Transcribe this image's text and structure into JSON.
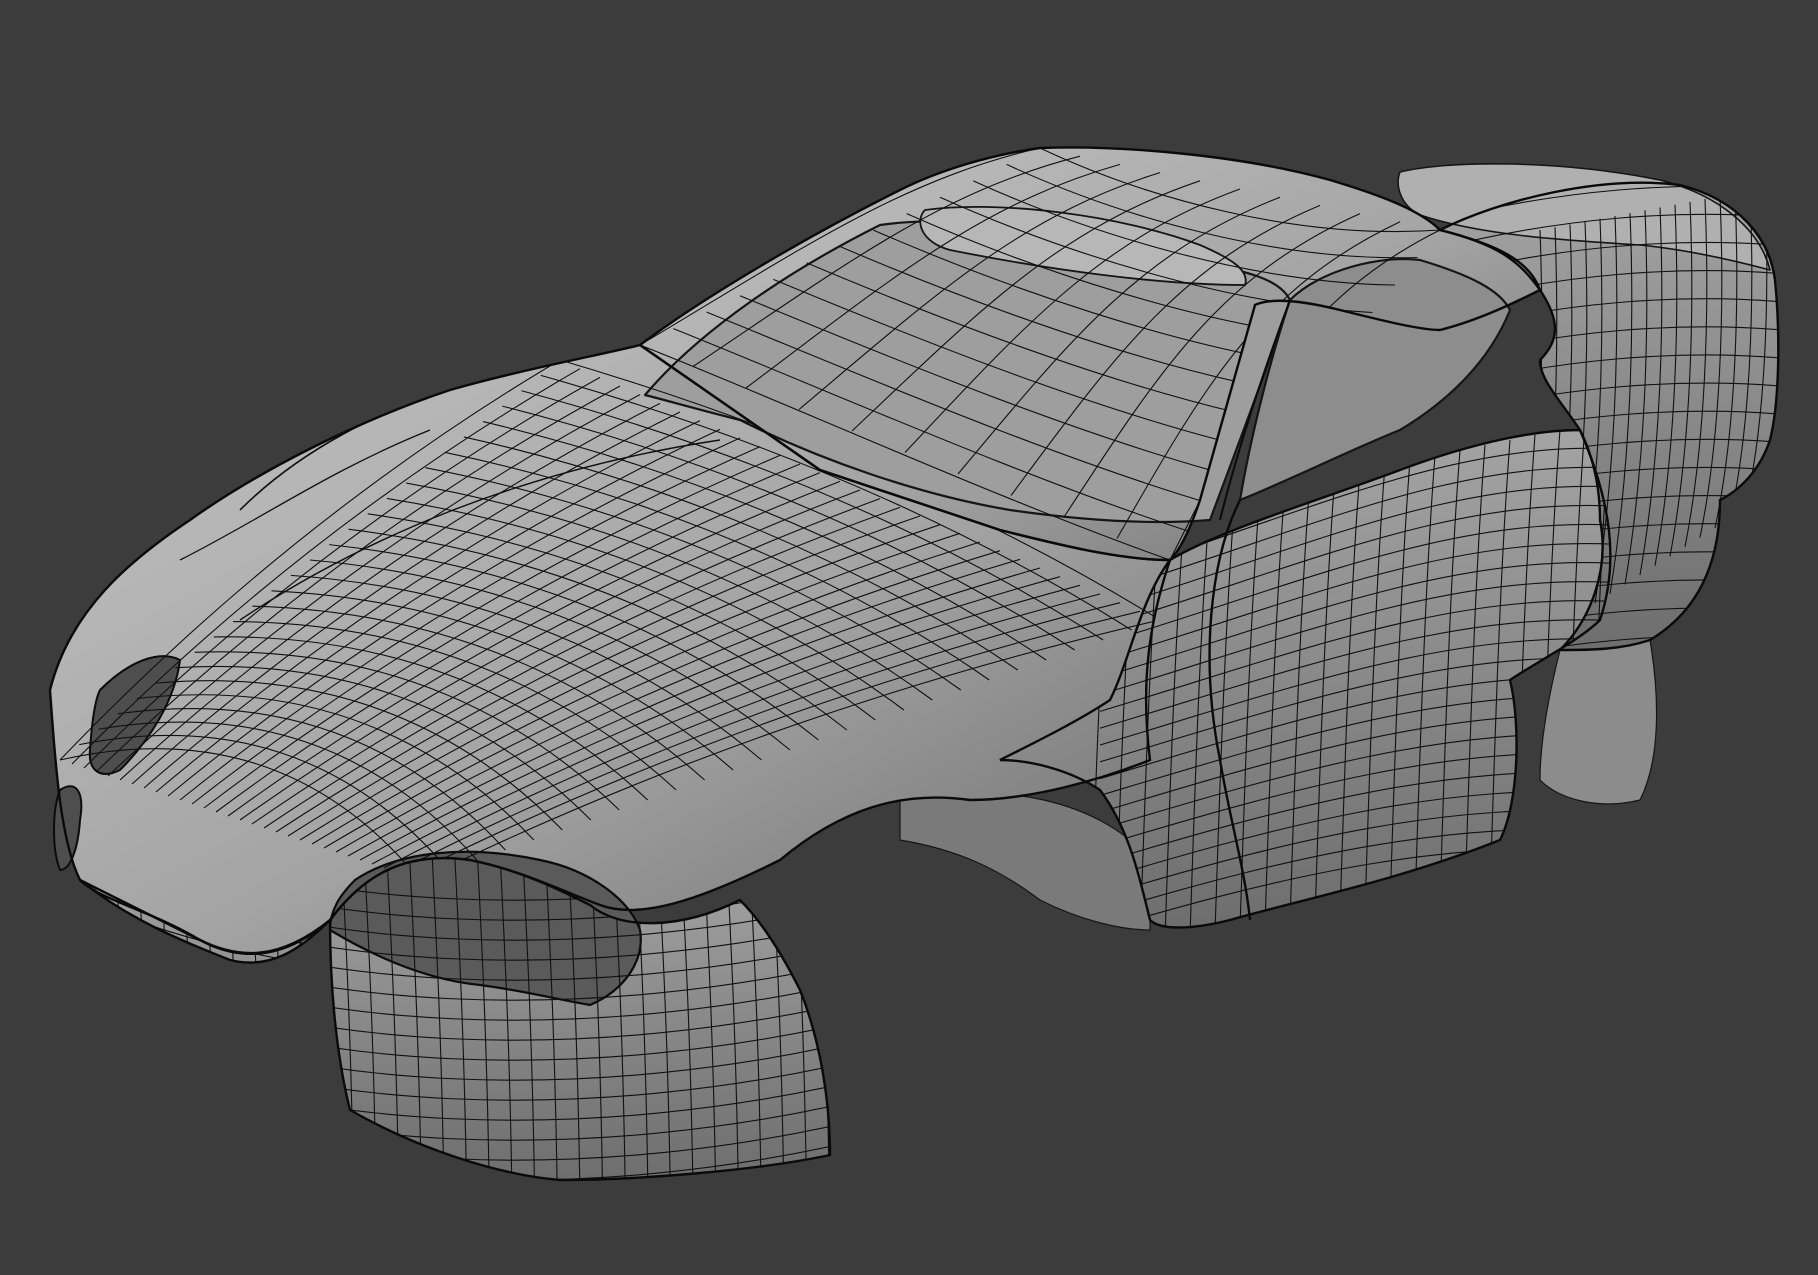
{
  "viewport": {
    "background_color": "#3c3c3c",
    "shading": "solid",
    "overlay": "wireframe"
  },
  "model": {
    "subject": "car-body-shell",
    "surface_color": "#a4a4a4",
    "shadow_color": "#6e6e6e",
    "highlight_color": "#c2c2c2",
    "wire_color": "#101010"
  }
}
